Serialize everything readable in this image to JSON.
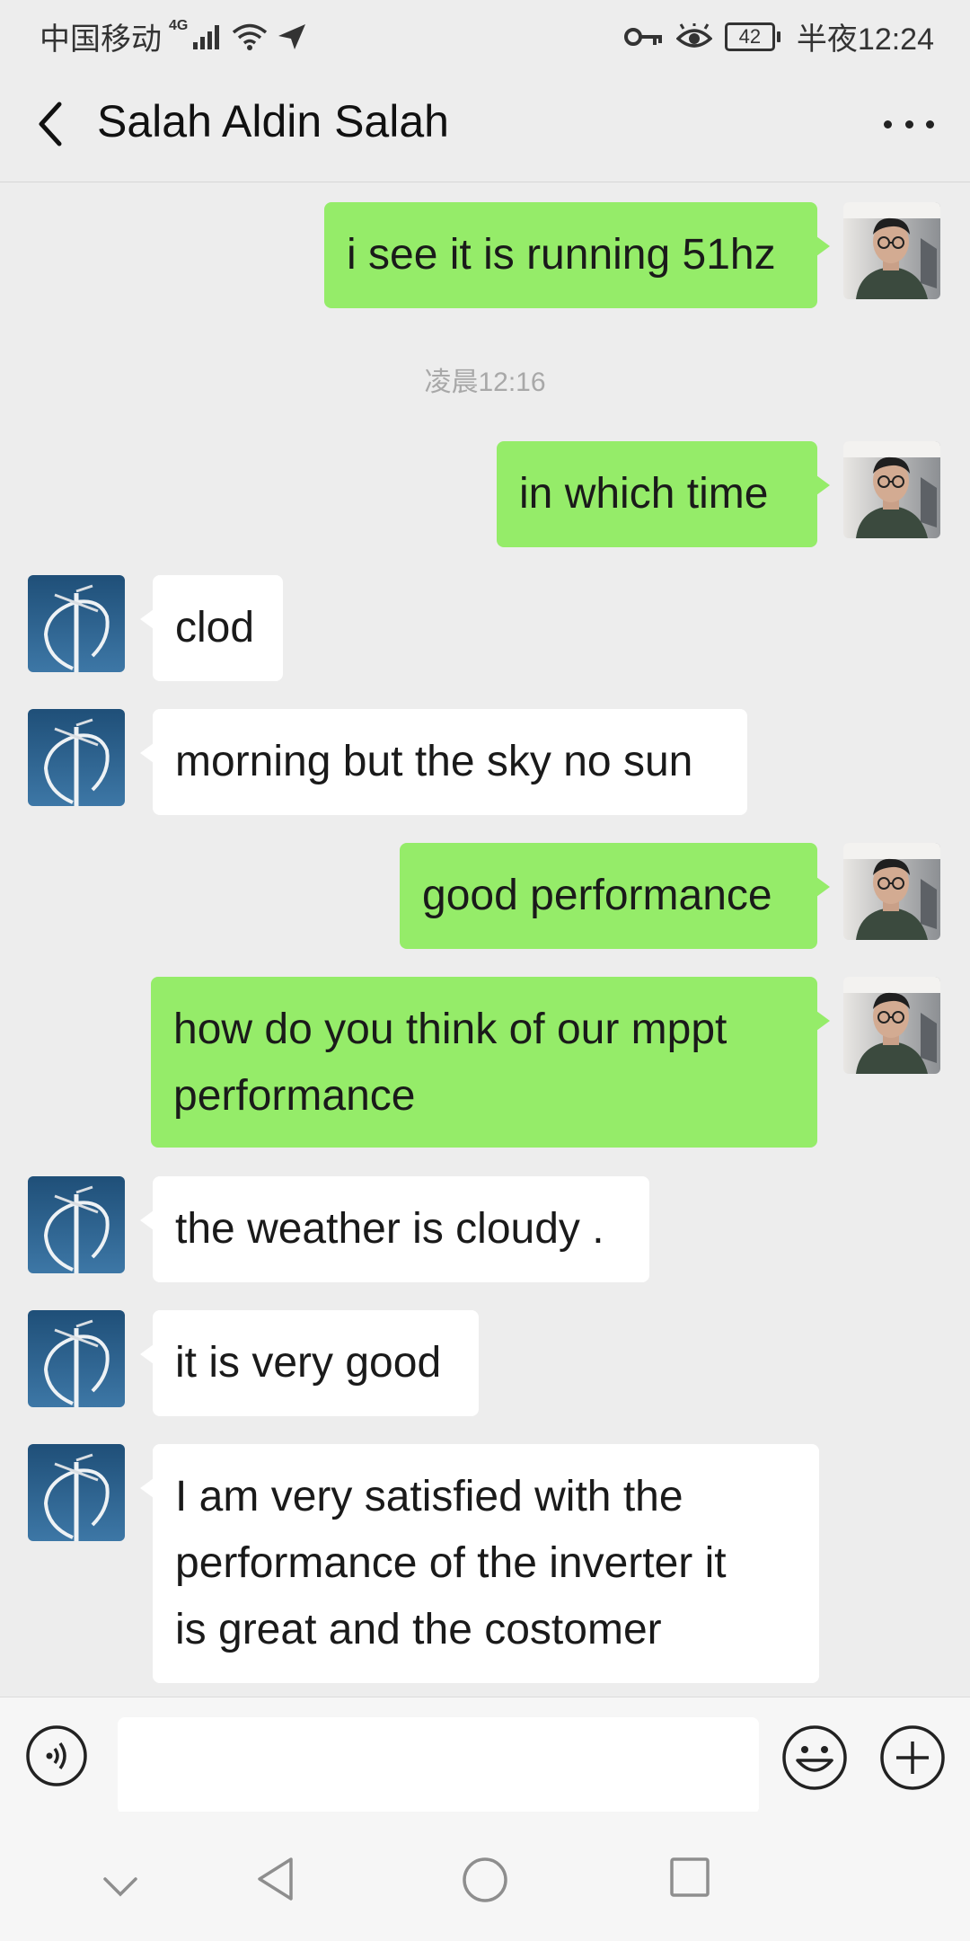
{
  "status_bar": {
    "carrier": "中国移动",
    "network": "4G",
    "battery": "42",
    "time": "半夜12:24",
    "icons": [
      "signal-icon",
      "wifi-icon",
      "send-icon",
      "key-icon",
      "eye-icon",
      "battery-icon"
    ]
  },
  "header": {
    "title": "Salah Aldin Salah",
    "back_icon": "back-arrow-icon",
    "more_icon": "more-options-icon"
  },
  "chat": {
    "timestamp": "凌晨12:16",
    "messages": [
      {
        "sender": "me",
        "text": "i see it is running 51hz"
      },
      {
        "sender": "me",
        "text": "in which time"
      },
      {
        "sender": "them",
        "text": "clod"
      },
      {
        "sender": "them",
        "text": "morning but the sky no sun"
      },
      {
        "sender": "me",
        "text": "good performance"
      },
      {
        "sender": "me",
        "lines": [
          "how do you think of our mppt",
          "performance"
        ]
      },
      {
        "sender": "them",
        "text": "the weather is cloudy ."
      },
      {
        "sender": "them",
        "text": "it is very good"
      },
      {
        "sender": "them",
        "lines": [
          "I am very satisfied with the",
          "performance of the inverter it",
          "is great and the costomer"
        ]
      }
    ]
  },
  "input_bar": {
    "placeholder": "",
    "icons": [
      "voice-icon",
      "emoji-icon",
      "plus-icon"
    ]
  },
  "nav_bar": {
    "icons": [
      "hide-keyboard-icon",
      "back-nav-icon",
      "home-nav-icon",
      "recents-nav-icon"
    ]
  },
  "colors": {
    "background": "#ededed",
    "my_bubble": "#95ec69",
    "their_bubble": "#ffffff",
    "timestamp_text": "#a8a8a8"
  }
}
